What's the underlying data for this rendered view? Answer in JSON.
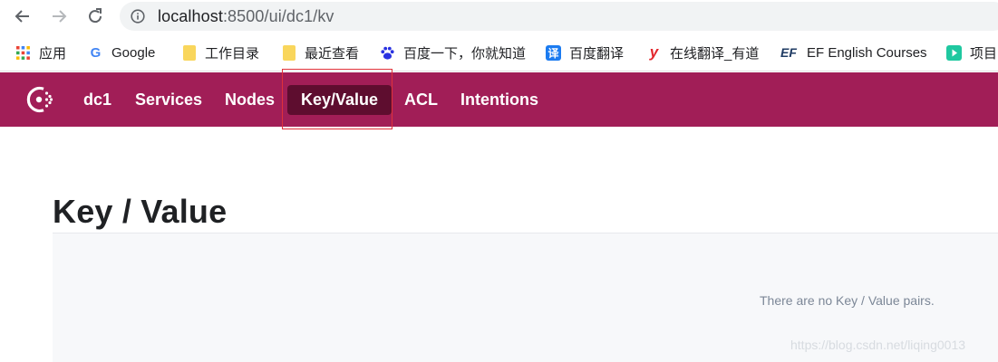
{
  "browser": {
    "url_host": "localhost",
    "url_rest": ":8500/ui/dc1/kv",
    "back_icon": "arrow-left-icon",
    "forward_icon": "arrow-right-icon",
    "reload_icon": "reload-icon",
    "info_icon": "info-icon"
  },
  "bookmarks": [
    {
      "label": "应用",
      "icon": "apps-grid-icon"
    },
    {
      "label": "Google",
      "icon": "google-icon",
      "icon_text": "G"
    },
    {
      "label": "工作目录",
      "icon": "folder-icon"
    },
    {
      "label": "最近查看",
      "icon": "folder-icon"
    },
    {
      "label": "百度一下，你就知道",
      "icon": "baidu-paw-icon"
    },
    {
      "label": "百度翻译",
      "icon": "baidu-translate-icon",
      "icon_text": "译"
    },
    {
      "label": "在线翻译_有道",
      "icon": "youdao-icon",
      "icon_text": "y"
    },
    {
      "label": "EF English Courses",
      "icon": "ef-icon",
      "icon_text": "EF"
    },
    {
      "label": "项目",
      "icon": "play-icon"
    }
  ],
  "appnav": {
    "logo": "consul-logo-icon",
    "items": [
      {
        "label": "dc1",
        "active": false
      },
      {
        "label": "Services",
        "active": false
      },
      {
        "label": "Nodes",
        "active": false
      },
      {
        "label": "Key/Value",
        "active": true
      },
      {
        "label": "ACL",
        "active": false
      },
      {
        "label": "Intentions",
        "active": false
      }
    ],
    "background_color": "#a11e57",
    "active_color": "#5e0d2f"
  },
  "main": {
    "title": "Key / Value",
    "empty_message": "There are no Key / Value pairs."
  },
  "watermark": "https://blog.csdn.net/liqing0013"
}
